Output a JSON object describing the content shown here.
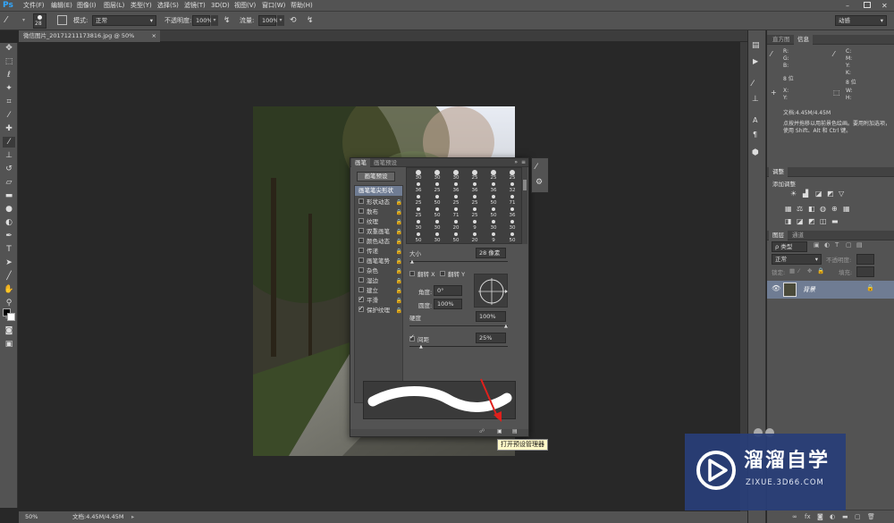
{
  "app": {
    "logo": "Ps"
  },
  "menu": [
    "文件(F)",
    "编辑(E)",
    "图像(I)",
    "图层(L)",
    "类型(Y)",
    "选择(S)",
    "滤镜(T)",
    "3D(D)",
    "视图(V)",
    "窗口(W)",
    "帮助(H)"
  ],
  "options": {
    "brush_size": "28",
    "mode_label": "模式:",
    "mode_value": "正常",
    "opacity_label": "不透明度:",
    "opacity_value": "100%",
    "flow_label": "流量:",
    "flow_value": "100%",
    "workspace": "动感"
  },
  "document": {
    "tab_title": "微信图片_20171211173816.jpg @ 50%(RGB/8#)",
    "close": "×"
  },
  "status": {
    "zoom": "50%",
    "doc_size": "文档:4.45M/4.45M"
  },
  "info_panel": {
    "tabs": [
      "直方图",
      "信息"
    ],
    "rgb_labels": [
      "R:",
      "G:",
      "B:"
    ],
    "cmyk_labels": [
      "C:",
      "M:",
      "Y:",
      "K:"
    ],
    "bits_left": "8 位",
    "bits_right": "8 位",
    "xy_labels": [
      "X:",
      "Y:"
    ],
    "wh_labels": [
      "W:",
      "H:"
    ],
    "doc_size": "文档:4.45M/4.45M",
    "hint": "点按并拖移以用前景色绘画。要用附加选项，使用 Shift、Alt 和 Ctrl 键。"
  },
  "adjustments": {
    "tab": "调整",
    "title": "添加调整"
  },
  "layers": {
    "tabs": [
      "图层",
      "通道"
    ],
    "kind": "ρ 类型",
    "blend": "正常",
    "opacity_label": "不透明度:",
    "lock_label": "锁定:",
    "fill_label": "填充:",
    "layer_name": "背景"
  },
  "brush_panel": {
    "tabs": [
      "画笔",
      "画笔预设"
    ],
    "preset_button": "画笔预设",
    "tip_shape": "画笔笔尖形状",
    "options": [
      {
        "label": "形状动态",
        "checked": false
      },
      {
        "label": "散布",
        "checked": false
      },
      {
        "label": "纹理",
        "checked": false
      },
      {
        "label": "双重画笔",
        "checked": false
      },
      {
        "label": "颜色动态",
        "checked": false
      },
      {
        "label": "传递",
        "checked": false
      },
      {
        "label": "画笔笔势",
        "checked": false
      },
      {
        "label": "杂色",
        "checked": false
      },
      {
        "label": "湿边",
        "checked": false
      },
      {
        "label": "建立",
        "checked": false
      },
      {
        "label": "平滑",
        "checked": true
      },
      {
        "label": "保护纹理",
        "checked": true
      }
    ],
    "brush_rows": [
      [
        "30",
        "30",
        "30",
        "25",
        "25",
        "25"
      ],
      [
        "36",
        "25",
        "36",
        "36",
        "36",
        "32"
      ],
      [
        "25",
        "50",
        "25",
        "25",
        "50",
        "71"
      ],
      [
        "25",
        "50",
        "71",
        "25",
        "50",
        "36"
      ],
      [
        "30",
        "30",
        "20",
        "9",
        "30",
        "30"
      ],
      [
        "50",
        "30",
        "50",
        "20",
        "9",
        "50"
      ]
    ],
    "size_label": "大小",
    "size_value": "28 像素",
    "flip_x": "翻转 X",
    "flip_y": "翻转 Y",
    "angle_label": "角度:",
    "angle_value": "0°",
    "roundness_label": "圆度:",
    "roundness_value": "100%",
    "hardness_label": "硬度",
    "hardness_value": "100%",
    "spacing_label": "间距",
    "spacing_value": "25%",
    "tooltip": "打开预设管理器"
  },
  "watermark": {
    "title": "溜溜自学",
    "url": "ZIXUE.3D66.COM"
  }
}
